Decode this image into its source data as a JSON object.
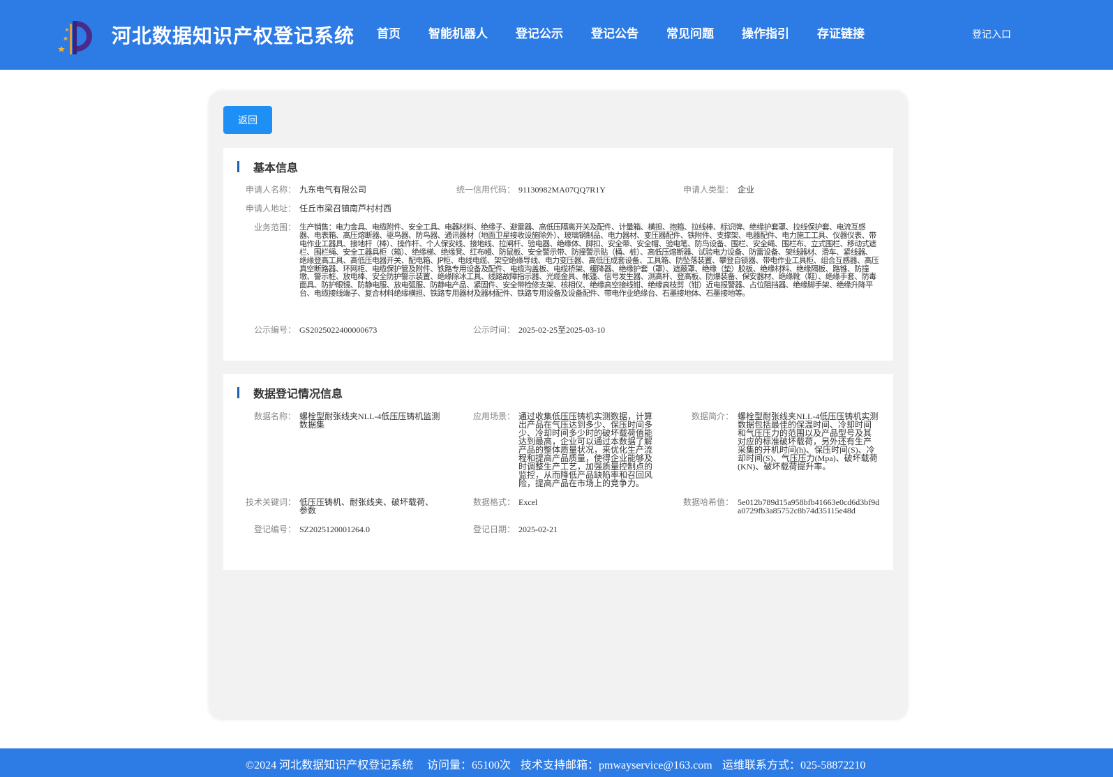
{
  "header": {
    "title": "河北数据知识产权登记系统",
    "nav": [
      "首页",
      "智能机器人",
      "登记公示",
      "登记公告",
      "常见问题",
      "操作指引",
      "存证链接"
    ],
    "login": "登记入口"
  },
  "actions": {
    "back": "返回"
  },
  "basic": {
    "title": "基本信息",
    "applicant_name_label": "申请人名称：",
    "applicant_name": "九东电气有限公司",
    "credit_code_label": "统一信用代码：",
    "credit_code": "91130982MA07QQ7R1Y",
    "applicant_type_label": "申请人类型：",
    "applicant_type": "企业",
    "address_label": "申请人地址：",
    "address": "任丘市梁召镇南芦村村西",
    "scope_label": "业务范围：",
    "scope": "生产销售：电力金具、电缆附件、安全工具、电器材料、绝缘子、避雷器、高低压隔离开关及配件、计量箱、横担、抱箍、拉线棒、标识牌、绝缘护套罩、拉线保护套、电流互感器、电表箱、高压熔断器、驱鸟器、防鸟器、通讯器材（地面卫星接收设施除外）、玻璃钢制品、电力器材、变压器配件、铁附件、支撑架、电器配件、电力施工工具、仪器仪表、带电作业工器具、接地杆（棒）、操作杆、个人保安线、接地线、拉闸杆、验电器、绝缘体、脚扣、安全带、安全帽、验电笔、防鸟设备、围栏、安全绳、围栏布、立式围栏、移动式遮栏、围栏绳、安全工器具柜（箱）、绝缘梯、绝缘凳、红布幔、防鼠板、安全警示带、防撞警示贴（桶、桩）、高低压熔断器、试验电力设备、防雷设备、架线器材、滑车、紧线器、绝缘登高工具、高低压电器开关、配电箱、JP柜、电线电缆、架空绝缘导线、电力变压器、高低压成套设备、工具箱、防坠落装置、攀登自锁器、带电作业工具柜、组合互感器、高压真空断路器、环网柜、电缆保护管及附件、铁路专用设备及配件、电缆沟盖板、电缆桥架、缓降器、绝缘护套（罩）、遮蔽罩、绝缘（垫）胶板、绝缘材料、绝缘隔板、路锥、防撞墩、警示桩、放电棒、安全防护警示装置、绝缘除冰工具、线路故障指示器、光缆金具、帐篷、信号发生器、测高杆、登高板、防爆装备、保安器材、绝缘靴（鞋）、绝缘手套、防毒面具、防护眼镜、防静电服、放电弧服、防静电产品、紧固件、安全带检修支架、核相仪、绝缘高空接线钳、绝缘高枝剪（钳）近电报警器、占位阻挡器、绝缘脚手架、绝缘升降平台、电缆接线端子、复合材料绝缘横担、铁路专用器材及器材配件、铁路专用设备及设备配件、带电作业绝缘台、石墨接地体、石墨接地等。",
    "pub_no_label": "公示编号：",
    "pub_no": "GS2025022400000673",
    "pub_time_label": "公示时间：",
    "pub_time": "2025-02-25至2025-03-10"
  },
  "data_reg": {
    "title": "数据登记情况信息",
    "name_label": "数据名称：",
    "name": "螺栓型耐张线夹NLL-4低压压铸机监测数据集",
    "scenario_label": "应用场景：",
    "scenario": "通过收集低压压铸机实测数据，计算出产品在气压达到多少、保压时间多少、冷却时间多少时的破坏载荷值能达到最高，企业可以通过本数据了解产品的整体质量状况，来优化生产流程和提高产品质量，使得企业能够及时调整生产工艺，加强质量控制点的监控，从而降低产品缺陷率和召回风险，提高产品在市场上的竞争力。",
    "intro_label": "数据简介：",
    "intro": "螺栓型耐张线夹NLL-4低压压铸机实测数据包括最佳的保温时间、冷却时间和气压压力的范围以及产品型号及其对应的标准破坏载荷，另外还有生产采集的开机时间(h)、保压时间(S)、冷却时间(S)、气压压力(Mpa)、破坏载荷(KN)、破坏载荷提升率。",
    "keywords_label": "技术关键词：",
    "keywords": "低压压铸机、耐张线夹、破坏载荷、参数",
    "format_label": "数据格式：",
    "format": "Excel",
    "hash_label": "数据哈希值：",
    "hash": "5e012b789d15a958bfb41663e0cd6d3bf9da0729fb3a85752c8b74d35115e48d",
    "reg_no_label": "登记编号：",
    "reg_no": "SZ2025120001264.0",
    "reg_date_label": "登记日期：",
    "reg_date": "2025-02-21"
  },
  "footer": {
    "copyright": "©2024 河北数据知识产权登记系统",
    "visits": "访问量：65100次",
    "email": "技术支持邮箱：pmwayservice@163.com",
    "phone": "运维联系方式：025-58872210"
  },
  "colors": {
    "header_bg": "#2d7ce6",
    "button": "#1e8ff4",
    "section_bar": "#1e5fb4",
    "panel_bg": "#f2f2f2"
  }
}
